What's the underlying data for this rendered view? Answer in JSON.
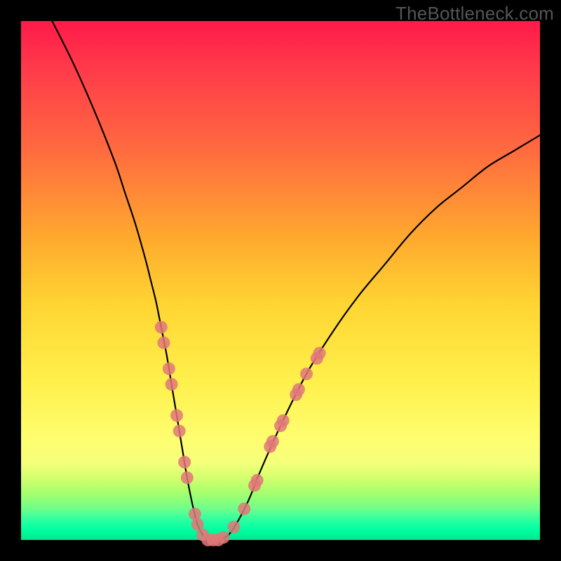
{
  "watermark": "TheBottleneck.com",
  "chart_data": {
    "type": "line",
    "title": "",
    "xlabel": "",
    "ylabel": "",
    "xlim": [
      0,
      100
    ],
    "ylim": [
      0,
      100
    ],
    "series": [
      {
        "name": "bottleneck-curve",
        "x": [
          6,
          10,
          14,
          18,
          20,
          22,
          24,
          25,
          26,
          27,
          28,
          29,
          30,
          31,
          32,
          33,
          34,
          35,
          36,
          38,
          40,
          42,
          44,
          46,
          50,
          55,
          60,
          65,
          70,
          75,
          80,
          85,
          90,
          95,
          100
        ],
        "values": [
          100,
          92,
          83,
          73,
          67,
          61,
          54,
          50,
          46,
          41,
          36,
          30,
          24,
          18,
          12,
          7,
          3,
          1,
          0,
          0,
          1,
          4,
          8,
          13,
          22,
          32,
          40,
          47,
          53,
          59,
          64,
          68,
          72,
          75,
          78
        ]
      }
    ],
    "markers": {
      "name": "highlighted-points",
      "color": "#e07878",
      "points": [
        {
          "x": 27.0,
          "y": 41
        },
        {
          "x": 27.5,
          "y": 38
        },
        {
          "x": 28.5,
          "y": 33
        },
        {
          "x": 29.0,
          "y": 30
        },
        {
          "x": 30.0,
          "y": 24
        },
        {
          "x": 30.5,
          "y": 21
        },
        {
          "x": 31.5,
          "y": 15
        },
        {
          "x": 32.0,
          "y": 12
        },
        {
          "x": 33.5,
          "y": 5
        },
        {
          "x": 34.0,
          "y": 3
        },
        {
          "x": 35.0,
          "y": 1
        },
        {
          "x": 36.0,
          "y": 0
        },
        {
          "x": 37.0,
          "y": 0
        },
        {
          "x": 38.0,
          "y": 0
        },
        {
          "x": 39.0,
          "y": 0.5
        },
        {
          "x": 41.0,
          "y": 2.5
        },
        {
          "x": 43.0,
          "y": 6
        },
        {
          "x": 45.0,
          "y": 10.5
        },
        {
          "x": 45.5,
          "y": 11.5
        },
        {
          "x": 48.0,
          "y": 18
        },
        {
          "x": 48.5,
          "y": 19
        },
        {
          "x": 50.0,
          "y": 22
        },
        {
          "x": 50.5,
          "y": 23
        },
        {
          "x": 53.0,
          "y": 28
        },
        {
          "x": 53.5,
          "y": 29
        },
        {
          "x": 55.0,
          "y": 32
        },
        {
          "x": 57.0,
          "y": 35
        },
        {
          "x": 57.5,
          "y": 36
        }
      ]
    },
    "gradient_stops": [
      {
        "pos": 0,
        "color": "#ff1a4a"
      },
      {
        "pos": 10,
        "color": "#ff3d4a"
      },
      {
        "pos": 25,
        "color": "#ff6b3f"
      },
      {
        "pos": 42,
        "color": "#ffaa2e"
      },
      {
        "pos": 55,
        "color": "#ffd633"
      },
      {
        "pos": 70,
        "color": "#fff14d"
      },
      {
        "pos": 80,
        "color": "#fffd6e"
      },
      {
        "pos": 85,
        "color": "#f6ff7a"
      },
      {
        "pos": 88,
        "color": "#d4ff6e"
      },
      {
        "pos": 91,
        "color": "#a6ff6e"
      },
      {
        "pos": 94,
        "color": "#6eff8a"
      },
      {
        "pos": 96,
        "color": "#30ffa0"
      },
      {
        "pos": 98,
        "color": "#00ffa1"
      },
      {
        "pos": 100,
        "color": "#00e890"
      }
    ]
  }
}
